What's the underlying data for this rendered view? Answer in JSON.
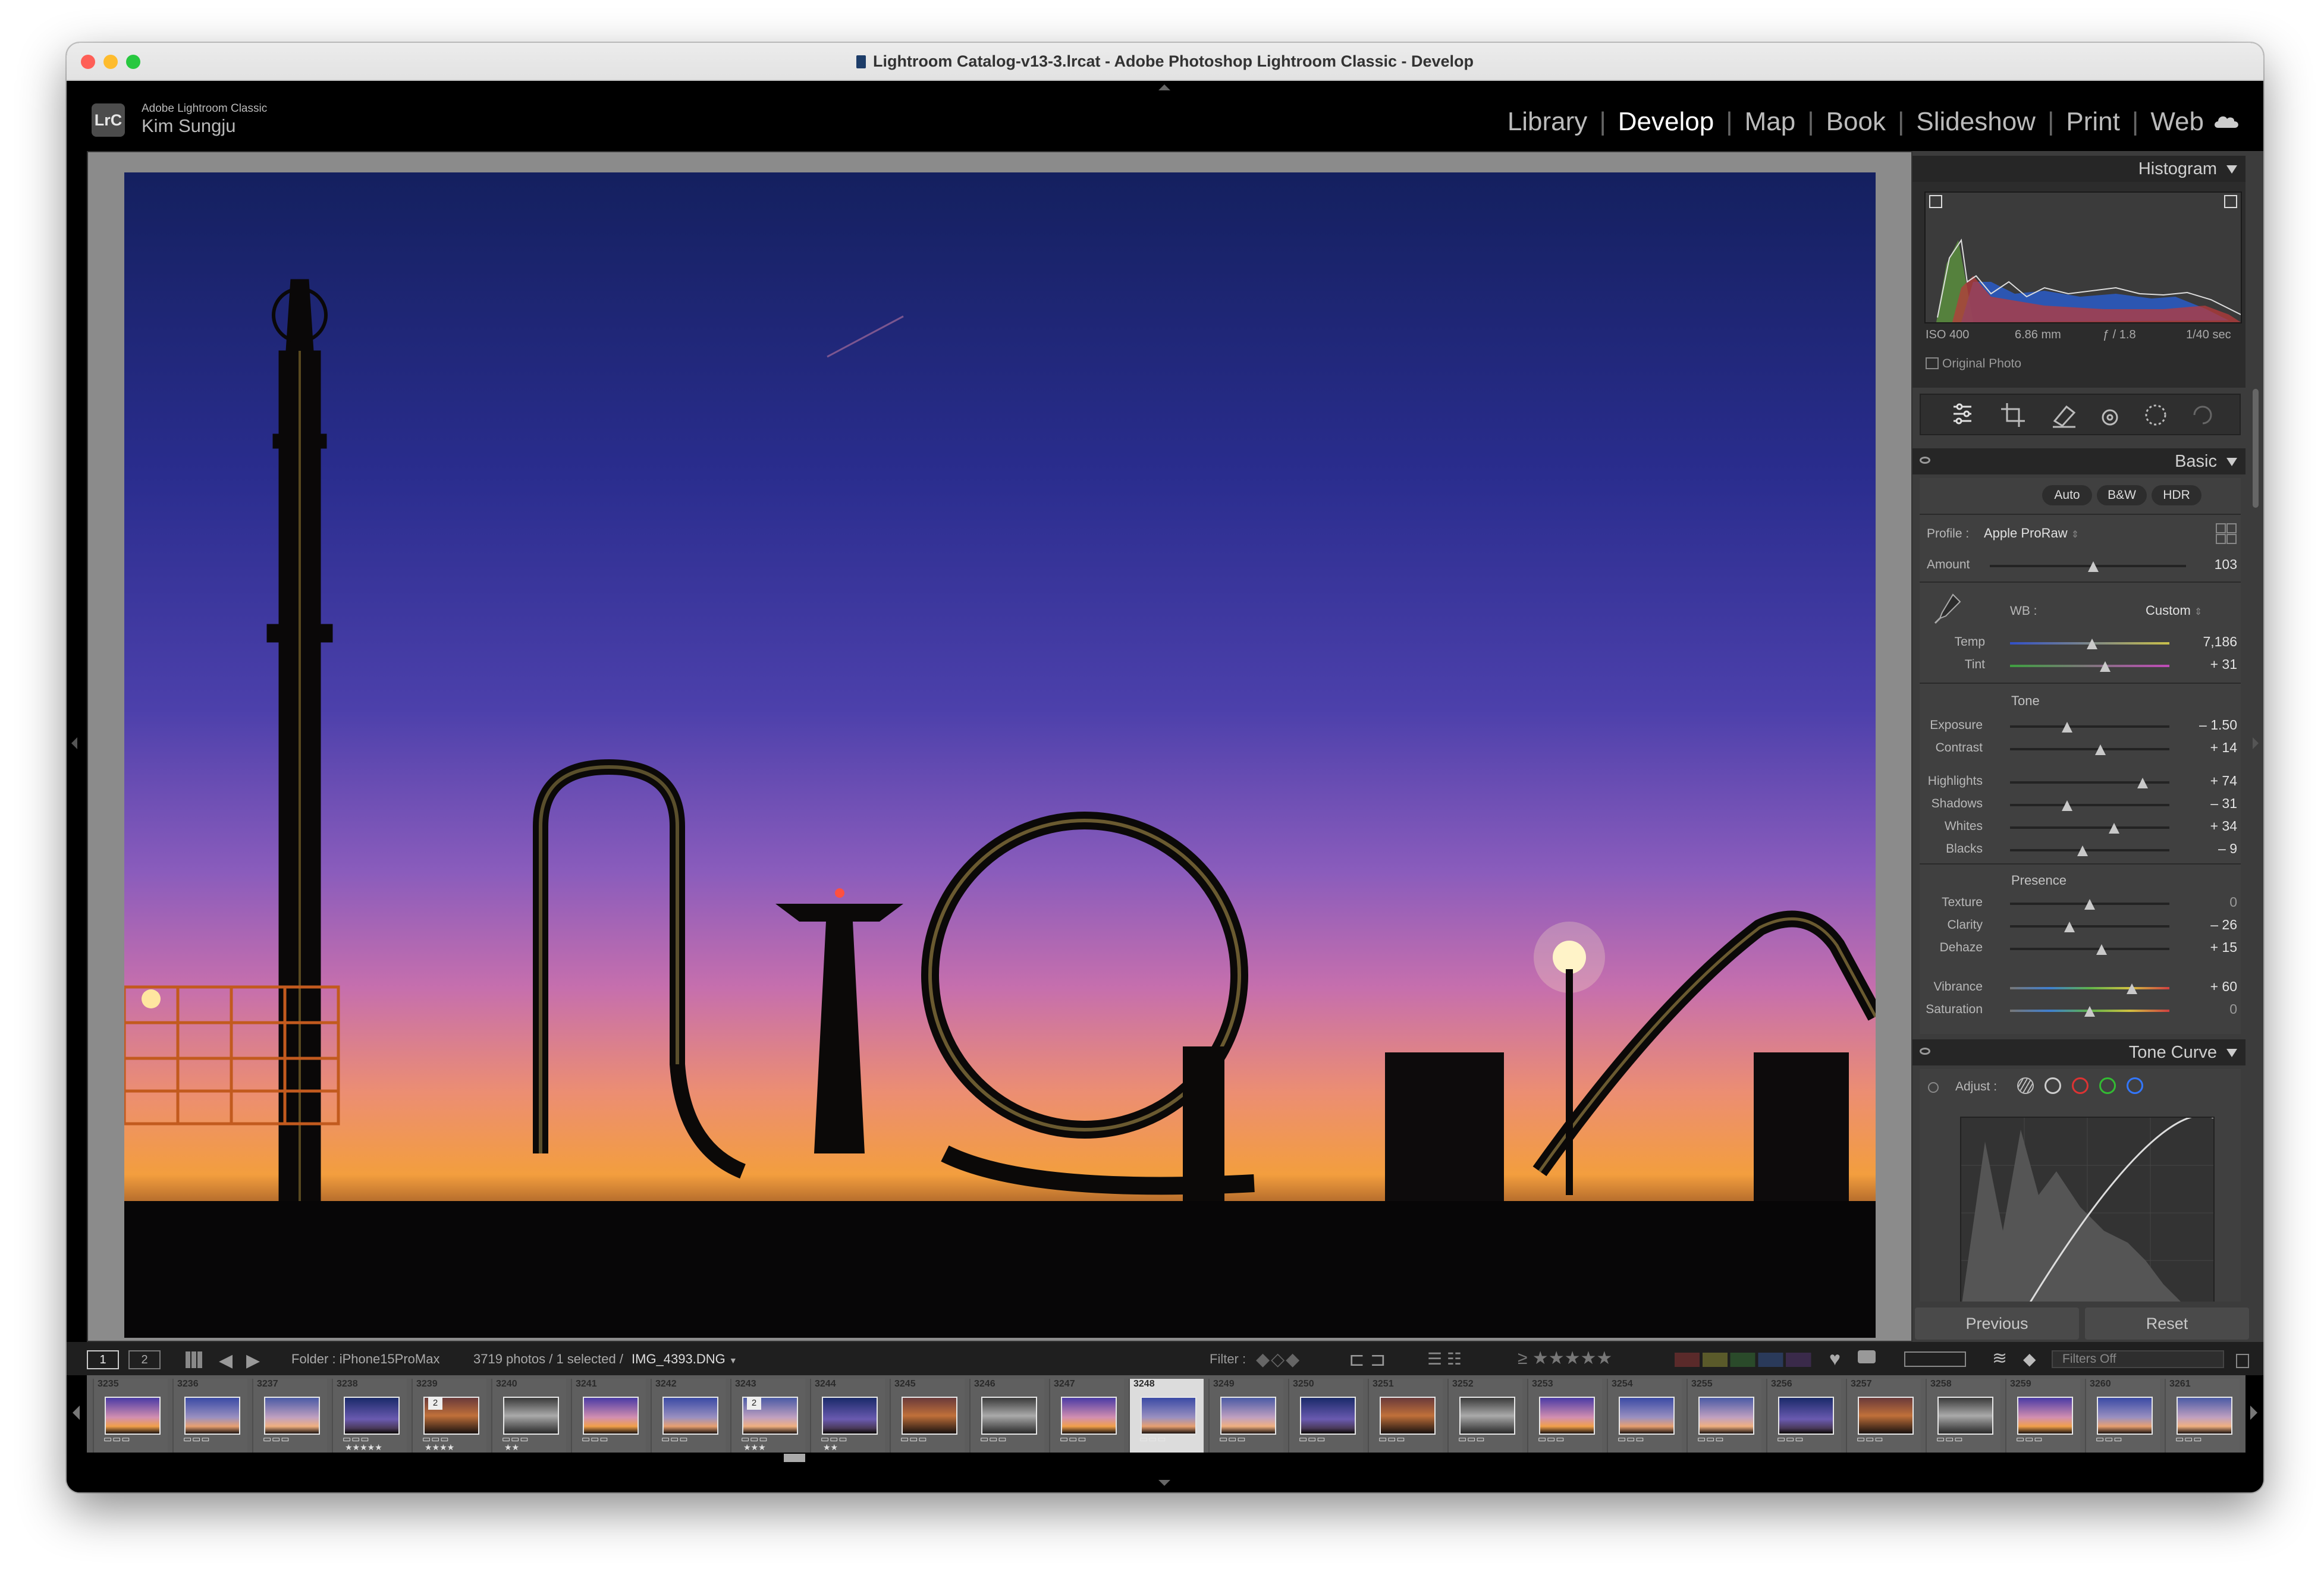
{
  "window": {
    "title": "Lightroom Catalog-v13-3.lrcat - Adobe Photoshop Lightroom Classic - Develop"
  },
  "identity": {
    "app_name": "Adobe Lightroom Classic",
    "user_name": "Kim Sungju",
    "logo_text": "LrC"
  },
  "modules": {
    "items": [
      "Library",
      "Develop",
      "Map",
      "Book",
      "Slideshow",
      "Print",
      "Web"
    ],
    "active": "Develop"
  },
  "histogram": {
    "header": "Histogram",
    "iso": "ISO 400",
    "focal": "6.86 mm",
    "aperture": "ƒ / 1.8",
    "shutter": "1/40 sec",
    "original_photo": "Original Photo"
  },
  "basic": {
    "header": "Basic",
    "buttons": [
      "Auto",
      "B&W",
      "HDR"
    ],
    "profile_label": "Profile :",
    "profile_value": "Apple ProRaw",
    "amount_label": "Amount",
    "amount_value": "103",
    "wb_label": "WB :",
    "wb_value": "Custom",
    "temp_label": "Temp",
    "temp_value": "7,186",
    "tint_label": "Tint",
    "tint_value": "+ 31",
    "tone_header": "Tone",
    "exposure_label": "Exposure",
    "exposure_value": "– 1.50",
    "contrast_label": "Contrast",
    "contrast_value": "+ 14",
    "highlights_label": "Highlights",
    "highlights_value": "+ 74",
    "shadows_label": "Shadows",
    "shadows_value": "– 31",
    "whites_label": "Whites",
    "whites_value": "+ 34",
    "blacks_label": "Blacks",
    "blacks_value": "– 9",
    "presence_header": "Presence",
    "texture_label": "Texture",
    "texture_value": "0",
    "clarity_label": "Clarity",
    "clarity_value": "– 26",
    "dehaze_label": "Dehaze",
    "dehaze_value": "+ 15",
    "vibrance_label": "Vibrance",
    "vibrance_value": "+ 60",
    "saturation_label": "Saturation",
    "saturation_value": "0"
  },
  "tone_curve": {
    "header": "Tone Curve",
    "adjust_label": "Adjust :"
  },
  "buttons": {
    "previous": "Previous",
    "reset": "Reset"
  },
  "filmstrip_bar": {
    "view1": "1",
    "view2": "2",
    "folder": "Folder : iPhone15ProMax",
    "count": "3719 photos / 1 selected /",
    "filename": "IMG_4393.DNG",
    "filter_label": "Filter :",
    "filters_off": "Filters Off"
  },
  "filmstrip": {
    "numbers": [
      "3235",
      "3236",
      "3237",
      "3238",
      "3239",
      "3240",
      "3241",
      "3242",
      "3243",
      "3244",
      "3245",
      "3246",
      "3247",
      "3248",
      "3249",
      "3250",
      "3251",
      "3252",
      "3253",
      "3254",
      "3255",
      "3256",
      "3257",
      "3258",
      "3259",
      "3260",
      "3261"
    ],
    "badges": {
      "4": "2",
      "8": "2"
    },
    "stars": {
      "3": "★★★★★",
      "4": "★★★★",
      "5": "★★",
      "8": "★★★",
      "9": "★★"
    },
    "selected_index": 13
  }
}
